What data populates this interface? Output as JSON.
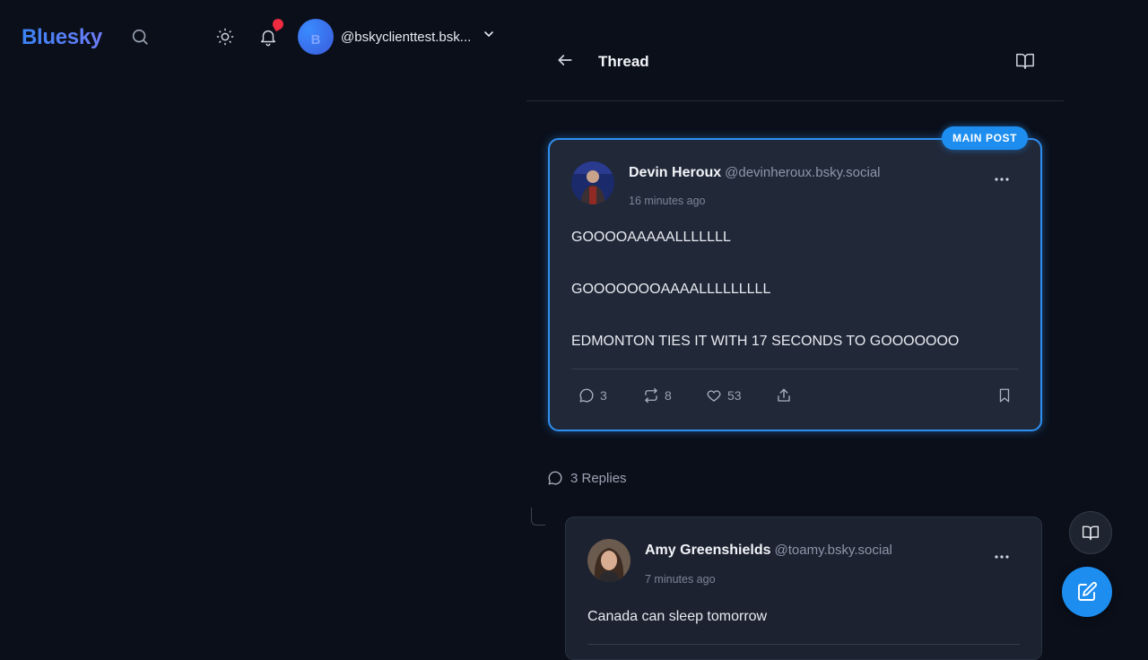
{
  "app": {
    "logo_text": "Bluesky",
    "account_avatar_letter": "B",
    "account_handle": "@bskyclienttest.bsk..."
  },
  "header": {
    "title": "Thread"
  },
  "main_post": {
    "badge": "MAIN POST",
    "author_name": "Devin Heroux",
    "author_handle": "@devinheroux.bsky.social",
    "time": "16 minutes ago",
    "lines": [
      "GOOOOAAAAALLLLLLL",
      "GOOOOOOOAAAALLLLLLLLL",
      "EDMONTON TIES IT WITH 17 SECONDS TO GOOOOOOO"
    ],
    "reply_count": "3",
    "repost_count": "8",
    "like_count": "53"
  },
  "replies": {
    "label": "3 Replies",
    "items": [
      {
        "author_name": "Amy Greenshields",
        "author_handle": "@toamy.bsky.social",
        "time": "7 minutes ago",
        "text": "Canada can sleep tomorrow"
      }
    ]
  },
  "colors": {
    "background": "#0b0f1a",
    "accent": "#1d8ef0",
    "card": "#212838",
    "notification_dot": "#ef2b3f"
  },
  "icons": {
    "search": "search-icon",
    "theme": "sun-icon",
    "notifications": "bell-icon",
    "back": "arrow-left-icon",
    "reader": "book-open-icon",
    "compose": "edit-icon"
  }
}
